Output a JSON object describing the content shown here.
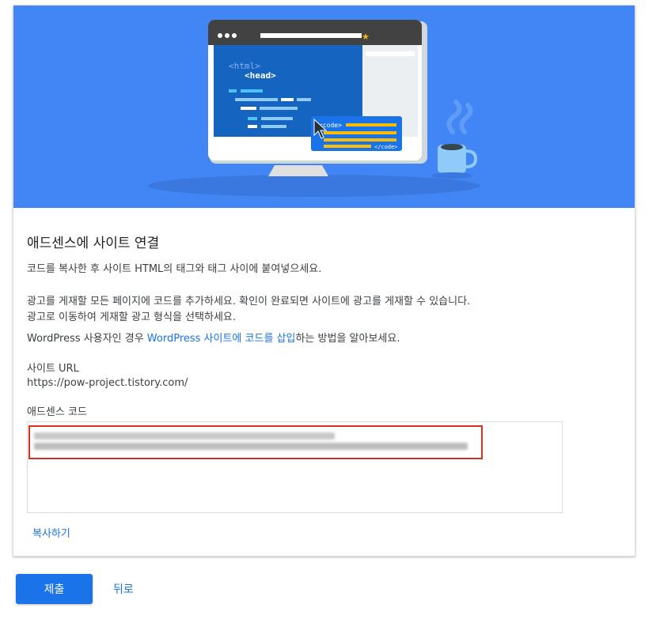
{
  "hero": {
    "code_open_html": "<html>",
    "code_open_head": "<head>",
    "code_tag_open": "<code>",
    "code_tag_close": "</code>"
  },
  "card": {
    "title": "애드센스에 사이트 연결",
    "instruction": "코드를 복사한 후 사이트 HTML의 태그와 태그 사이에 붙여넣으세요.",
    "paragraph_line1": "광고를 게재할 모든 페이지에 코드를 추가하세요. 확인이 완료되면 사이트에 광고를 게재할 수 있습니다.",
    "paragraph_line2": "광고로 이동하여 게재할 광고 형식을 선택하세요.",
    "wp_prefix": "WordPress 사용자인 경우 ",
    "wp_link": "WordPress 사이트에 코드를 삽입",
    "wp_suffix": "하는 방법을 알아보세요.",
    "site_url_label": "사이트 URL",
    "site_url_value": "https://pow-project.tistory.com/",
    "code_label": "애드센스 코드",
    "copy_button": "복사하기"
  },
  "actions": {
    "submit": "제출",
    "back": "뒤로"
  },
  "colors": {
    "hero_bg": "#4285f4",
    "link": "#1a73e8",
    "highlight_border": "#d93025"
  }
}
